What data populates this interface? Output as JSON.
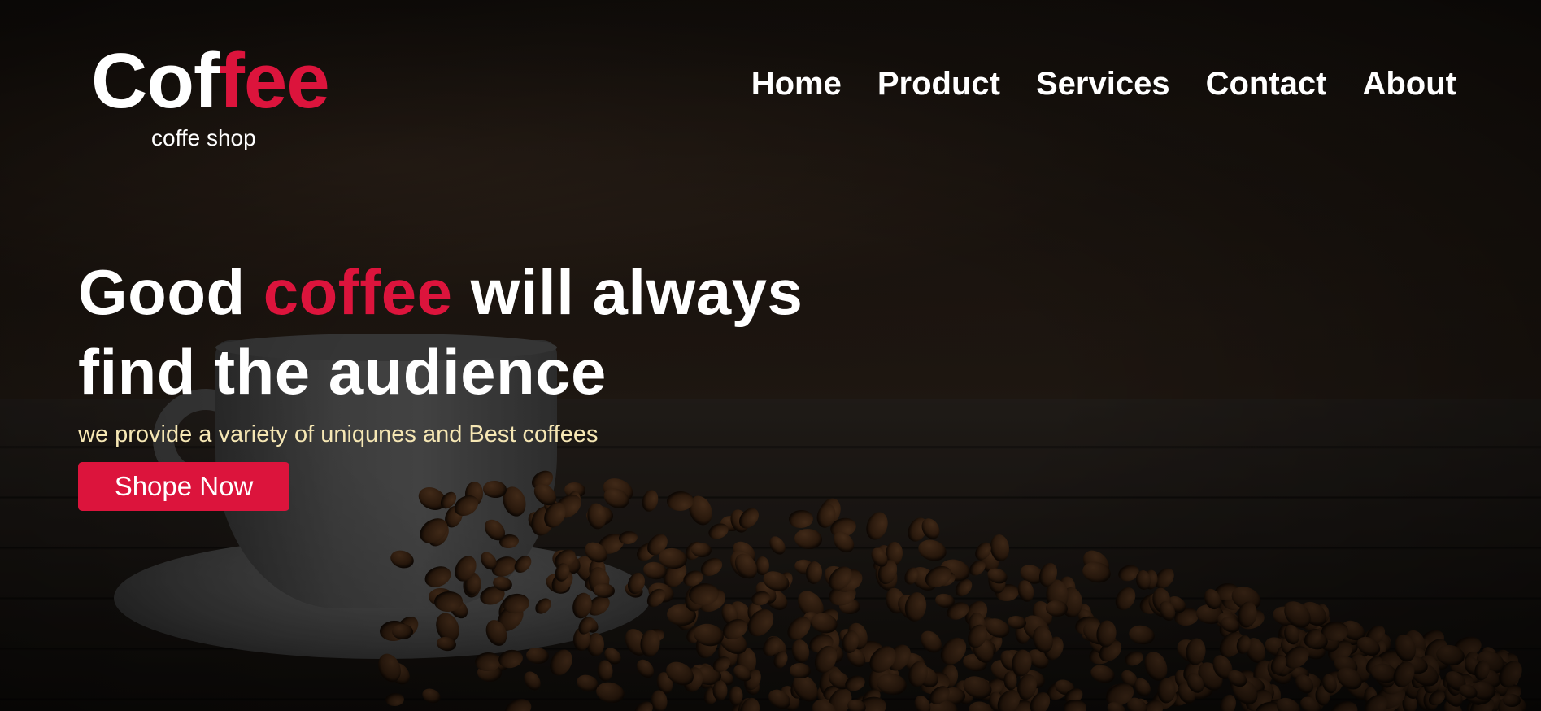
{
  "colors": {
    "accent": "#dc143c",
    "text": "#ffffff",
    "subtitle": "#f6e7b4"
  },
  "logo": {
    "title_start": "Cof",
    "title_accent": "fee",
    "subtitle": "coffe shop"
  },
  "nav": {
    "items": [
      {
        "label": "Home"
      },
      {
        "label": "Product"
      },
      {
        "label": "Services"
      },
      {
        "label": "Contact"
      },
      {
        "label": "About"
      }
    ]
  },
  "hero": {
    "title_part1": "Good ",
    "title_accent": "coffee",
    "title_part2": " will always",
    "title_line2": "find the audience",
    "subtitle": "we provide a variety of uniqunes and Best coffees",
    "button_label": "Shope Now"
  },
  "background": {
    "icon": "coffee-cup-and-beans-image"
  }
}
